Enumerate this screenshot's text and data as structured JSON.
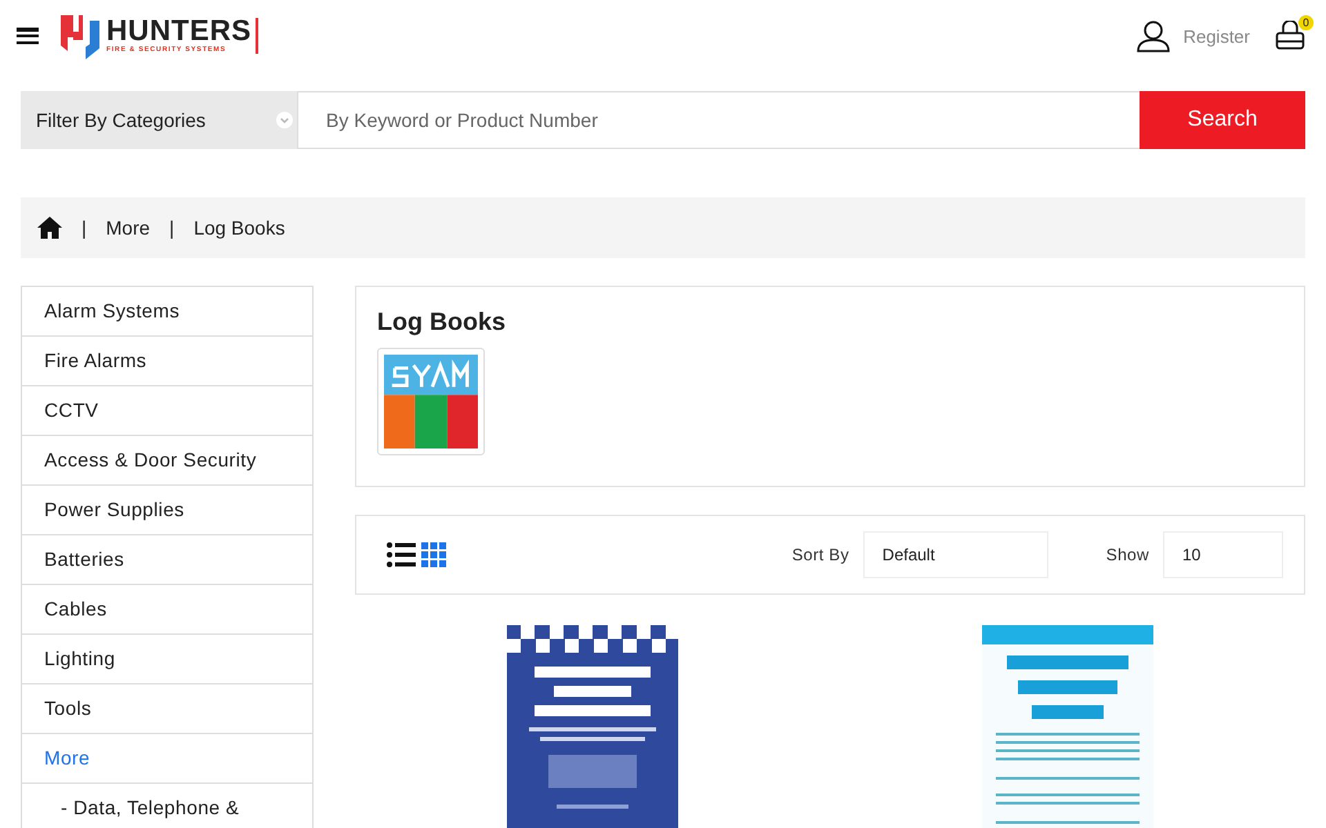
{
  "header": {
    "logo": {
      "name": "HUNTERS",
      "tagline": "FIRE & SECURITY SYSTEMS"
    },
    "register": "Register",
    "cart_count": "0"
  },
  "search": {
    "category_filter": "Filter By Categories",
    "placeholder": "By Keyword or Product Number",
    "button": "Search"
  },
  "breadcrumb": [
    {
      "separator": "|",
      "label": "More"
    },
    {
      "separator": "|",
      "label": "Log Books"
    }
  ],
  "sidebar": {
    "items": [
      {
        "label": "Alarm Systems",
        "selected": false
      },
      {
        "label": "Fire Alarms",
        "selected": false
      },
      {
        "label": "CCTV",
        "selected": false
      },
      {
        "label": "Access & Door Security",
        "selected": false
      },
      {
        "label": "Power Supplies",
        "selected": false
      },
      {
        "label": "Batteries",
        "selected": false
      },
      {
        "label": "Cables",
        "selected": false
      },
      {
        "label": "Lighting",
        "selected": false
      },
      {
        "label": "Tools",
        "selected": false
      },
      {
        "label": "More",
        "selected": true,
        "children": [
          {
            "label": "- Data, Telephone &",
            "selected": false
          }
        ]
      }
    ]
  },
  "category": {
    "title": "Log Books"
  },
  "toolbar": {
    "views": [
      {
        "kind": "list",
        "selected": false
      },
      {
        "kind": "grid",
        "selected": true
      }
    ],
    "sort_label": "Sort By",
    "sort_value": "Default",
    "show_label": "Show",
    "show_value": "10"
  },
  "products": [
    {
      "kind": "intruder"
    },
    {
      "kind": "accident"
    }
  ]
}
